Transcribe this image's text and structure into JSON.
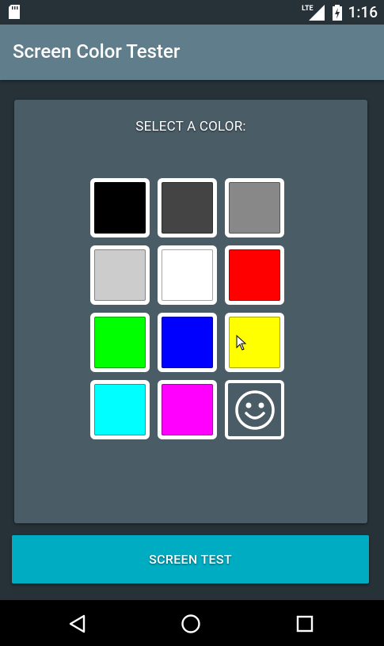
{
  "status_bar": {
    "network_label": "LTE",
    "time": "1:16",
    "icons": [
      "sd-card-icon",
      "signal-icon",
      "battery-charging-icon"
    ]
  },
  "app_bar": {
    "title": "Screen Color Tester"
  },
  "panel": {
    "title": "SELECT A COLOR:",
    "swatches": [
      {
        "name": "black",
        "color": "#000000"
      },
      {
        "name": "dark-gray",
        "color": "#444444"
      },
      {
        "name": "gray",
        "color": "#888888"
      },
      {
        "name": "light-gray",
        "color": "#cccccc"
      },
      {
        "name": "white",
        "color": "#ffffff"
      },
      {
        "name": "red",
        "color": "#ff0000"
      },
      {
        "name": "green",
        "color": "#00ff00"
      },
      {
        "name": "blue",
        "color": "#0000ff"
      },
      {
        "name": "yellow",
        "color": "#ffff00"
      },
      {
        "name": "cyan",
        "color": "#00ffff"
      },
      {
        "name": "magenta",
        "color": "#ff00ff"
      },
      {
        "name": "random",
        "icon": "smiley-icon"
      }
    ]
  },
  "actions": {
    "screen_test_label": "SCREEN TEST"
  },
  "nav_bar": {
    "icons": [
      "back-icon",
      "home-icon",
      "recents-icon"
    ]
  }
}
